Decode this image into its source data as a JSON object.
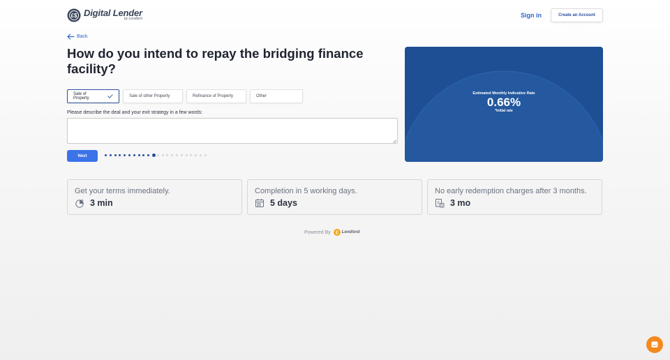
{
  "header": {
    "logo_title": "Digital Lender",
    "logo_subtitle": "by Lendlord",
    "signin_label": "Sign in",
    "create_account_label": "Create an Account"
  },
  "back_label": "Back",
  "question": "How do you intend to repay the bridging finance facility?",
  "options": [
    {
      "label": "Sale of Property",
      "selected": true
    },
    {
      "label": "Sale of other Property",
      "selected": false
    },
    {
      "label": "Refinance of Property",
      "selected": false
    },
    {
      "label": "Other",
      "selected": false
    }
  ],
  "describe": {
    "label": "Please describe the deal and your exit strategy in a few words:",
    "value": "",
    "placeholder": ""
  },
  "next_label": "Next",
  "progress": {
    "total_steps": 22,
    "current_step": 10
  },
  "rate_card": {
    "label": "Estimated Monthly Indicative Rate",
    "value": "0.66%",
    "sub": "*Initial rate",
    "colors": {
      "bg": "#1e4f94",
      "arc": "#2a60a8"
    }
  },
  "features": [
    {
      "title": "Get your terms immediately.",
      "value": "3 min",
      "icon": "timer-icon"
    },
    {
      "title": "Completion in 5 working days.",
      "value": "5 days",
      "icon": "calendar-icon"
    },
    {
      "title": "No early redemption charges after 3 months.",
      "value": "3 mo",
      "icon": "fee-document-icon"
    }
  ],
  "footer": {
    "powered_label": "Powered By",
    "brand": "Lendlord"
  },
  "colors": {
    "accent": "#3b73e8",
    "brand_dark": "#2a4f9c",
    "chat": "#f28a1e"
  }
}
